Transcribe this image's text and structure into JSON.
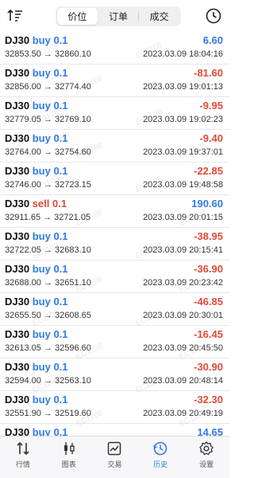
{
  "header": {
    "tabs": [
      {
        "label": "价位",
        "active": true
      },
      {
        "label": "订单",
        "active": false
      },
      {
        "label": "成交",
        "active": false
      }
    ],
    "left_icon": "sort-icon",
    "right_icon": "history-clock-icon"
  },
  "colors": {
    "buy": "#2f7ae5",
    "sell": "#e04a3a",
    "profit": "#2f7ae5",
    "loss": "#e04a3a",
    "active_tab": "#2f7ae5"
  },
  "trades": [
    {
      "symbol": "DJ30",
      "side": "buy",
      "lot": "0.1",
      "prices": "32853.50 → 32860.10",
      "pl": "6.60",
      "time": "2023.03.09 18:04:16"
    },
    {
      "symbol": "DJ30",
      "side": "buy",
      "lot": "0.1",
      "prices": "32856.00 → 32774.40",
      "pl": "-81.60",
      "time": "2023.03.09 19:01:13"
    },
    {
      "symbol": "DJ30",
      "side": "buy",
      "lot": "0.1",
      "prices": "32779.05 → 32769.10",
      "pl": "-9.95",
      "time": "2023.03.09 19:02:23"
    },
    {
      "symbol": "DJ30",
      "side": "buy",
      "lot": "0.1",
      "prices": "32764.00 → 32754.60",
      "pl": "-9.40",
      "time": "2023.03.09 19:37:01"
    },
    {
      "symbol": "DJ30",
      "side": "buy",
      "lot": "0.1",
      "prices": "32746.00 → 32723.15",
      "pl": "-22.85",
      "time": "2023.03.09 19:48:58"
    },
    {
      "symbol": "DJ30",
      "side": "sell",
      "lot": "0.1",
      "prices": "32911.65 → 32721.05",
      "pl": "190.60",
      "time": "2023.03.09 20:01:15"
    },
    {
      "symbol": "DJ30",
      "side": "buy",
      "lot": "0.1",
      "prices": "32722.05 → 32683.10",
      "pl": "-38.95",
      "time": "2023.03.09 20:15:41"
    },
    {
      "symbol": "DJ30",
      "side": "buy",
      "lot": "0.1",
      "prices": "32688.00 → 32651.10",
      "pl": "-36.90",
      "time": "2023.03.09 20:23:42"
    },
    {
      "symbol": "DJ30",
      "side": "buy",
      "lot": "0.1",
      "prices": "32655.50 → 32608.65",
      "pl": "-46.85",
      "time": "2023.03.09 20:30:01"
    },
    {
      "symbol": "DJ30",
      "side": "buy",
      "lot": "0.1",
      "prices": "32613.05 → 32596.60",
      "pl": "-16.45",
      "time": "2023.03.09 20:45:50"
    },
    {
      "symbol": "DJ30",
      "side": "buy",
      "lot": "0.1",
      "prices": "32594.00 → 32563.10",
      "pl": "-30.90",
      "time": "2023.03.09 20:48:14"
    },
    {
      "symbol": "DJ30",
      "side": "buy",
      "lot": "0.1",
      "prices": "32551.90 → 32519.60",
      "pl": "-32.30",
      "time": "2023.03.09 20:49:19"
    },
    {
      "symbol": "DJ30",
      "side": "buy",
      "lot": "0.1",
      "prices": "",
      "pl": "14.65",
      "time": ""
    }
  ],
  "watermark": "EC1108",
  "tabbar": [
    {
      "label": "行情",
      "icon": "quotes-arrows-icon",
      "active": false
    },
    {
      "label": "图表",
      "icon": "candlestick-chart-icon",
      "active": false
    },
    {
      "label": "交易",
      "icon": "trade-chart-icon",
      "active": false
    },
    {
      "label": "历史",
      "icon": "history-clock-icon",
      "active": true
    },
    {
      "label": "设置",
      "icon": "settings-gear-icon",
      "active": false
    }
  ]
}
